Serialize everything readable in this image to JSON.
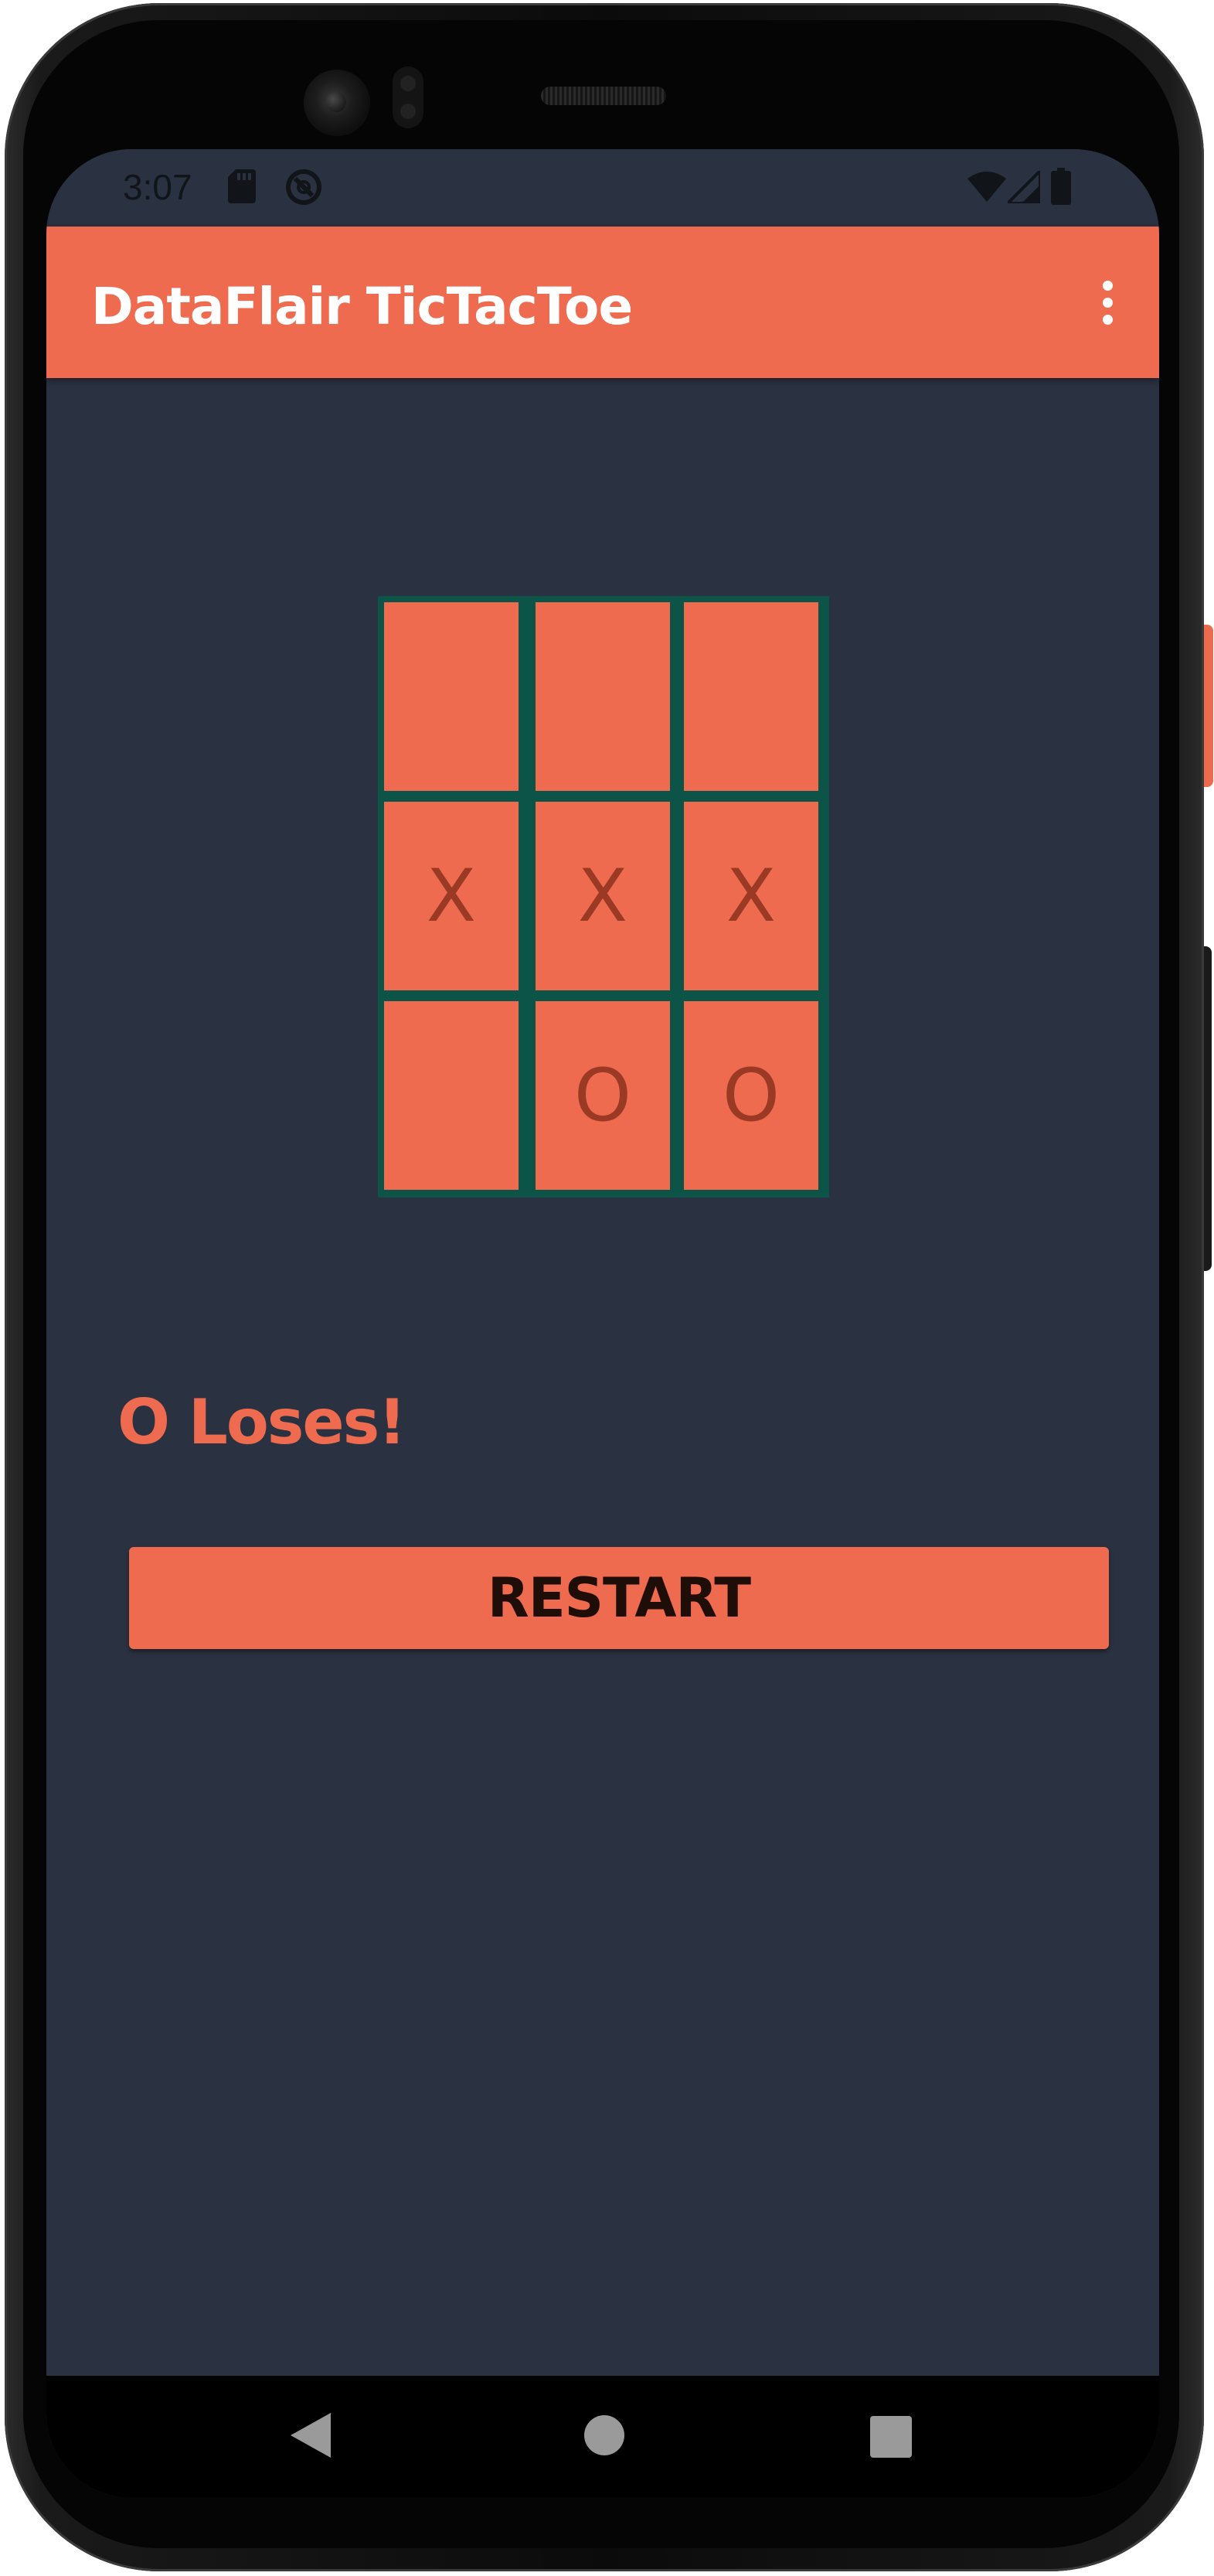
{
  "status_bar": {
    "time": "3:07",
    "icons": [
      "sd-card-icon",
      "sync-icon",
      "wifi-icon",
      "cell-signal-icon",
      "battery-icon"
    ]
  },
  "app_bar": {
    "title": "DataFlair TicTacToe",
    "menu_icon": "overflow-menu-icon"
  },
  "board": {
    "rows": [
      [
        "",
        "",
        ""
      ],
      [
        "X",
        "X",
        "X"
      ],
      [
        "",
        "O",
        "O"
      ]
    ]
  },
  "result": {
    "text": "O Loses!"
  },
  "restart": {
    "label": "RESTART"
  },
  "nav_bar": {
    "buttons": [
      "back-icon",
      "home-icon",
      "recents-icon"
    ]
  },
  "colors": {
    "accent": "#ee6b4f",
    "background": "#2a3140",
    "grid_lines": "#0c5448",
    "mark": "#9a3a24"
  }
}
